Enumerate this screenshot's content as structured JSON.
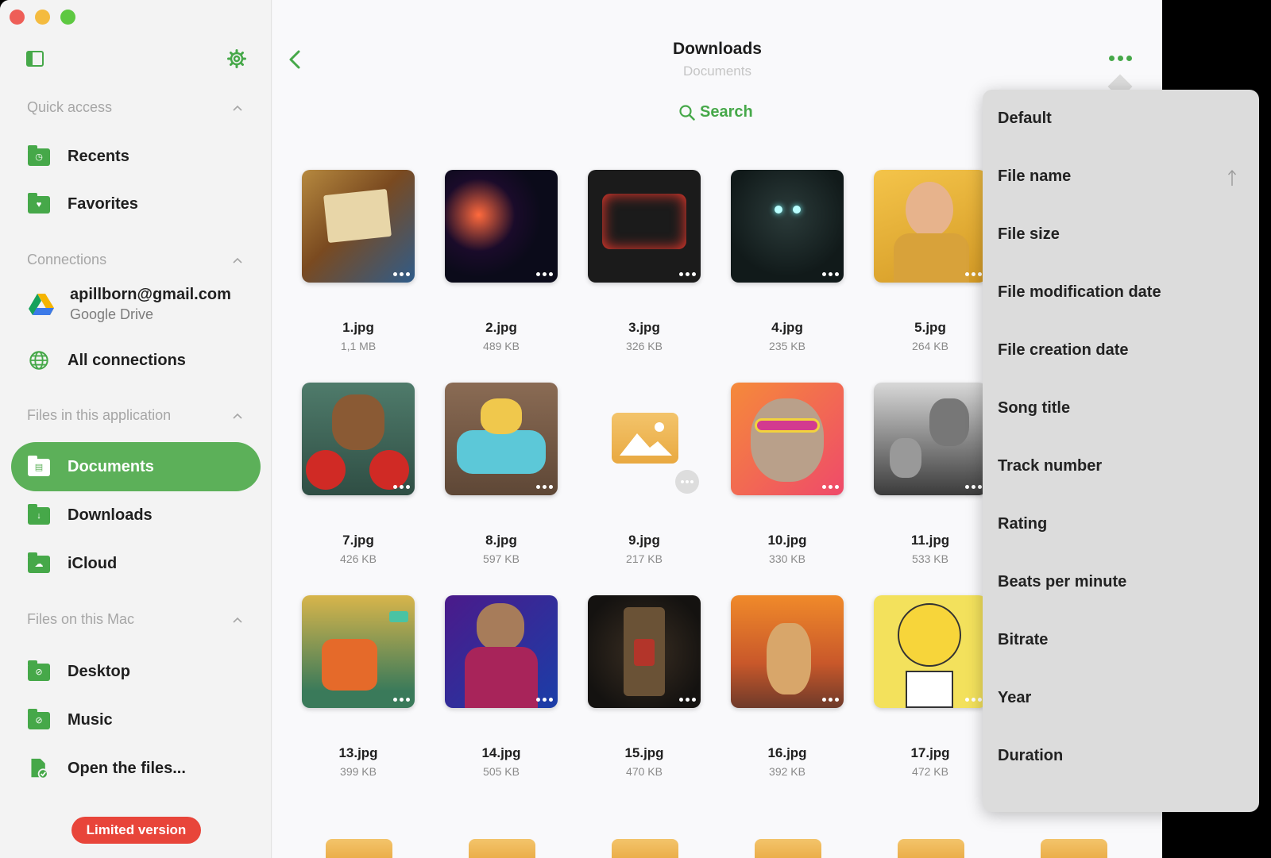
{
  "sidebar": {
    "sections": {
      "quick_access": "Quick access",
      "connections": "Connections",
      "files_app": "Files in this application",
      "files_mac": "Files on this Mac"
    },
    "items": {
      "recents": "Recents",
      "favorites": "Favorites",
      "all_connections": "All connections",
      "documents": "Documents",
      "downloads": "Downloads",
      "icloud": "iCloud",
      "desktop": "Desktop",
      "music": "Music",
      "open_files": "Open the files..."
    },
    "account": {
      "email": "apillborn@gmail.com",
      "service": "Google Drive"
    },
    "limited": "Limited version"
  },
  "header": {
    "title": "Downloads",
    "subtitle": "Documents",
    "search": "Search"
  },
  "files": [
    {
      "name": "1.jpg",
      "size": "1,1 MB"
    },
    {
      "name": "2.jpg",
      "size": "489 KB"
    },
    {
      "name": "3.jpg",
      "size": "326 KB"
    },
    {
      "name": "4.jpg",
      "size": "235 KB"
    },
    {
      "name": "5.jpg",
      "size": "264 KB"
    },
    {
      "name": "7.jpg",
      "size": "426 KB"
    },
    {
      "name": "8.jpg",
      "size": "597 KB"
    },
    {
      "name": "9.jpg",
      "size": "217 KB"
    },
    {
      "name": "10.jpg",
      "size": "330 KB"
    },
    {
      "name": "11.jpg",
      "size": "533 KB"
    },
    {
      "name": "13.jpg",
      "size": "399 KB"
    },
    {
      "name": "14.jpg",
      "size": "505 KB"
    },
    {
      "name": "15.jpg",
      "size": "470 KB"
    },
    {
      "name": "16.jpg",
      "size": "392 KB"
    },
    {
      "name": "17.jpg",
      "size": "472 KB"
    }
  ],
  "sort_menu": {
    "items": [
      "Default",
      "File name",
      "File size",
      "File modification date",
      "File creation date",
      "Song title",
      "Track number",
      "Rating",
      "Beats per minute",
      "Bitrate",
      "Year",
      "Duration"
    ],
    "selected": "File name",
    "direction": "ascending"
  },
  "colors": {
    "accent": "#46a849",
    "active": "#5cb059",
    "limited": "#e8453a"
  }
}
